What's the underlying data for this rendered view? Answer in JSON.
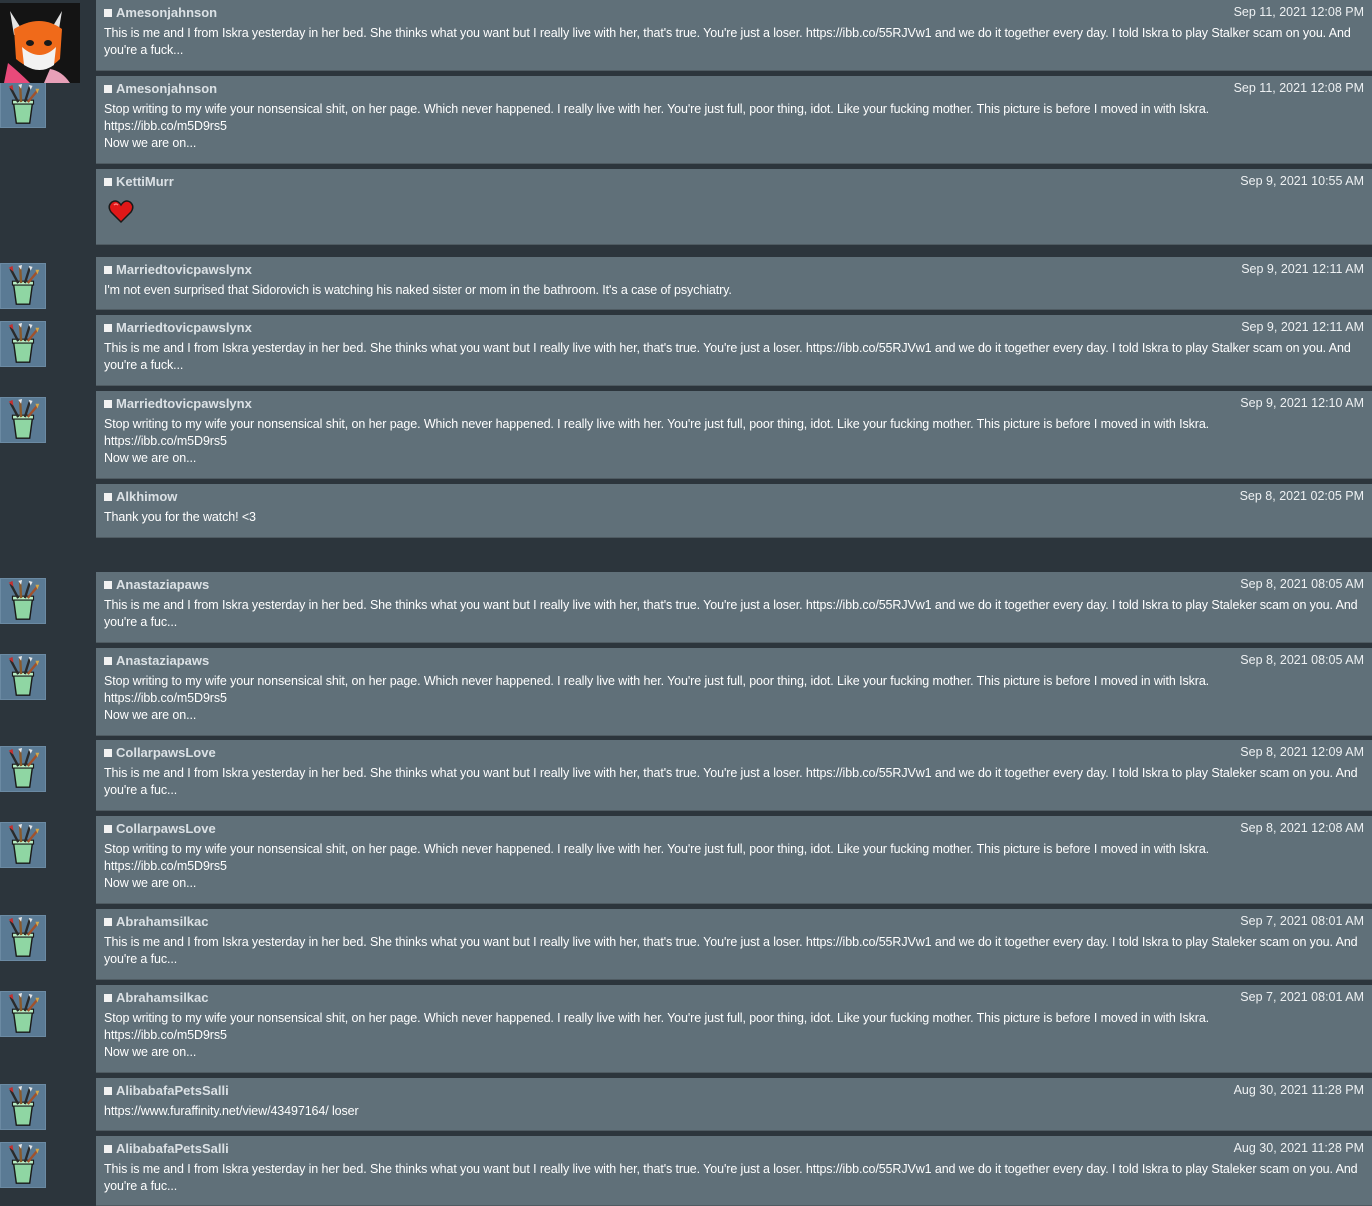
{
  "comments": [
    {
      "username": "Amesonjahnson",
      "date": "Sep 11, 2021 12:08 PM",
      "avatar": "brush-jar-icon",
      "text": "This is me and I from Iskra yesterday in her bed. She thinks what you want but I really live with her, that's true. You're just a loser. https://ibb.co/55RJVw1 and we do it together every day. I told Iskra to play Stalker scam on you. And you're a fuck..."
    },
    {
      "username": "Amesonjahnson",
      "date": "Sep 11, 2021 12:08 PM",
      "avatar": "brush-jar-icon",
      "text": "Stop writing to my wife your nonsensical shit, on her page. Which never happened. I really live with her. You're just full, poor thing, idot. Like your fucking mother. This picture is before I moved in with Iskra.\nhttps://ibb.co/m5D9rs5\nNow we are on..."
    },
    {
      "username": "KettiMurr",
      "date": "Sep 9, 2021 10:55 AM",
      "avatar": "wolf-avatar",
      "text": "",
      "emoji": "heart-icon"
    },
    {
      "username": "Marriedtovicpawslynx",
      "date": "Sep 9, 2021 12:11 AM",
      "avatar": "brush-jar-icon",
      "text": "I'm not even surprised that Sidorovich is watching his naked sister or mom in the bathroom. It's a case of psychiatry."
    },
    {
      "username": "Marriedtovicpawslynx",
      "date": "Sep 9, 2021 12:11 AM",
      "avatar": "brush-jar-icon",
      "text": "This is me and I from Iskra yesterday in her bed. She thinks what you want but I really live with her, that's true. You're just a loser. https://ibb.co/55RJVw1 and we do it together every day. I told Iskra to play Stalker scam on you. And you're a fuck..."
    },
    {
      "username": "Marriedtovicpawslynx",
      "date": "Sep 9, 2021 12:10 AM",
      "avatar": "brush-jar-icon",
      "text": "Stop writing to my wife your nonsensical shit, on her page. Which never happened. I really live with her. You're just full, poor thing, idot. Like your fucking mother. This picture is before I moved in with Iskra.\nhttps://ibb.co/m5D9rs5\nNow we are on..."
    },
    {
      "username": "Alkhimow",
      "date": "Sep 8, 2021 02:05 PM",
      "avatar": "fox-avatar",
      "text": "Thank you for the watch! <3"
    },
    {
      "username": "Anastaziapaws",
      "date": "Sep 8, 2021 08:05 AM",
      "avatar": "brush-jar-icon",
      "text": "This is me and I from Iskra yesterday in her bed. She thinks what you want but I really live with her, that's true. You're just a loser. https://ibb.co/55RJVw1 and we do it together every day. I told Iskra to play Staleker scam on you. And you're a fuc..."
    },
    {
      "username": "Anastaziapaws",
      "date": "Sep 8, 2021 08:05 AM",
      "avatar": "brush-jar-icon",
      "text": "Stop writing to my wife your nonsensical shit, on her page. Which never happened. I really live with her. You're just full, poor thing, idot. Like your fucking mother. This picture is before I moved in with Iskra.\nhttps://ibb.co/m5D9rs5\nNow we are on..."
    },
    {
      "username": "CollarpawsLove",
      "date": "Sep 8, 2021 12:09 AM",
      "avatar": "brush-jar-icon",
      "text": "This is me and I from Iskra yesterday in her bed. She thinks what you want but I really live with her, that's true. You're just a loser. https://ibb.co/55RJVw1 and we do it together every day. I told Iskra to play Staleker scam on you. And you're a fuc..."
    },
    {
      "username": "CollarpawsLove",
      "date": "Sep 8, 2021 12:08 AM",
      "avatar": "brush-jar-icon",
      "text": "Stop writing to my wife your nonsensical shit, on her page. Which never happened. I really live with her. You're just full, poor thing, idot. Like your fucking mother. This picture is before I moved in with Iskra.\nhttps://ibb.co/m5D9rs5\nNow we are on..."
    },
    {
      "username": "Abrahamsilkac",
      "date": "Sep 7, 2021 08:01 AM",
      "avatar": "brush-jar-icon",
      "text": "This is me and I from Iskra yesterday in her bed. She thinks what you want but I really live with her, that's true. You're just a loser. https://ibb.co/55RJVw1 and we do it together every day. I told Iskra to play Staleker scam on you. And you're a fuc..."
    },
    {
      "username": "Abrahamsilkac",
      "date": "Sep 7, 2021 08:01 AM",
      "avatar": "brush-jar-icon",
      "text": "Stop writing to my wife your nonsensical shit, on her page. Which never happened. I really live with her. You're just full, poor thing, idot. Like your fucking mother. This picture is before I moved in with Iskra.\nhttps://ibb.co/m5D9rs5\nNow we are on..."
    },
    {
      "username": "AlibabafaPetsSalli",
      "date": "Aug 30, 2021 11:28 PM",
      "avatar": "brush-jar-icon",
      "text": "https://www.furaffinity.net/view/43497164/ loser"
    },
    {
      "username": "AlibabafaPetsSalli",
      "date": "Aug 30, 2021 11:28 PM",
      "avatar": "brush-jar-icon",
      "text": "This is me and I from Iskra yesterday in her bed. She thinks what you want but I really live with her, that's true. You're just a loser. https://ibb.co/55RJVw1 and we do it together every day. I told Iskra to play Staleker scam on you. And you're a fuc..."
    }
  ]
}
